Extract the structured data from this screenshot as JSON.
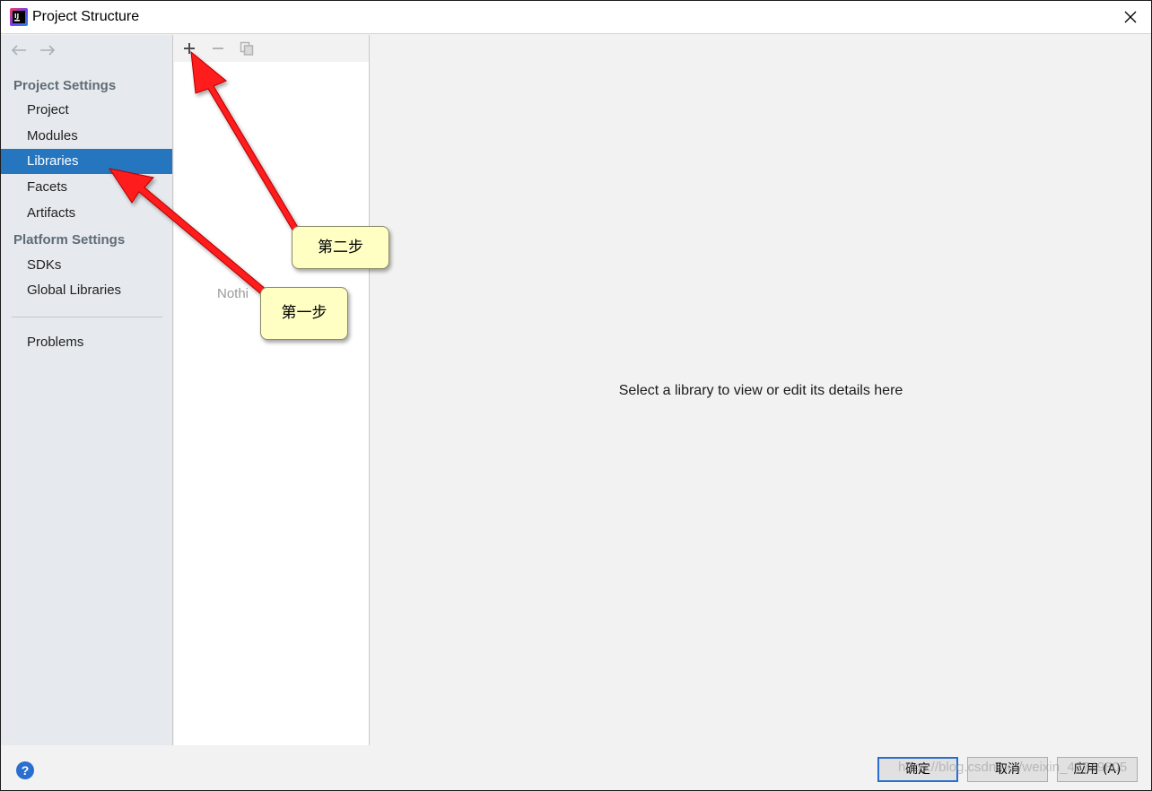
{
  "window": {
    "title": "Project Structure",
    "app_icon": "intellij-icon",
    "close_icon": "close-icon"
  },
  "navigation": {
    "back_icon": "arrow-left-icon",
    "forward_icon": "arrow-right-icon"
  },
  "sidebar": {
    "project_settings_header": "Project Settings",
    "platform_settings_header": "Platform Settings",
    "items": {
      "project": "Project",
      "modules": "Modules",
      "libraries": "Libraries",
      "facets": "Facets",
      "artifacts": "Artifacts",
      "sdks": "SDKs",
      "global_libraries": "Global Libraries",
      "problems": "Problems"
    },
    "selected": "Libraries"
  },
  "list_panel": {
    "add_icon": "plus-icon",
    "remove_icon": "minus-icon",
    "copy_icon": "copy-icon",
    "empty_text": "Nothi"
  },
  "details": {
    "placeholder": "Select a library to view or edit its details here"
  },
  "footer": {
    "help_label": "?",
    "ok_label": "确定",
    "cancel_label": "取消",
    "apply_label": "应用 (A)"
  },
  "annotations": {
    "step1": "第一步",
    "step2": "第二步",
    "arrow_color": "#ff1a1a",
    "callout_color": "#ffffc4"
  },
  "watermark": "https://blog.csdn.net/weixin_43749805"
}
